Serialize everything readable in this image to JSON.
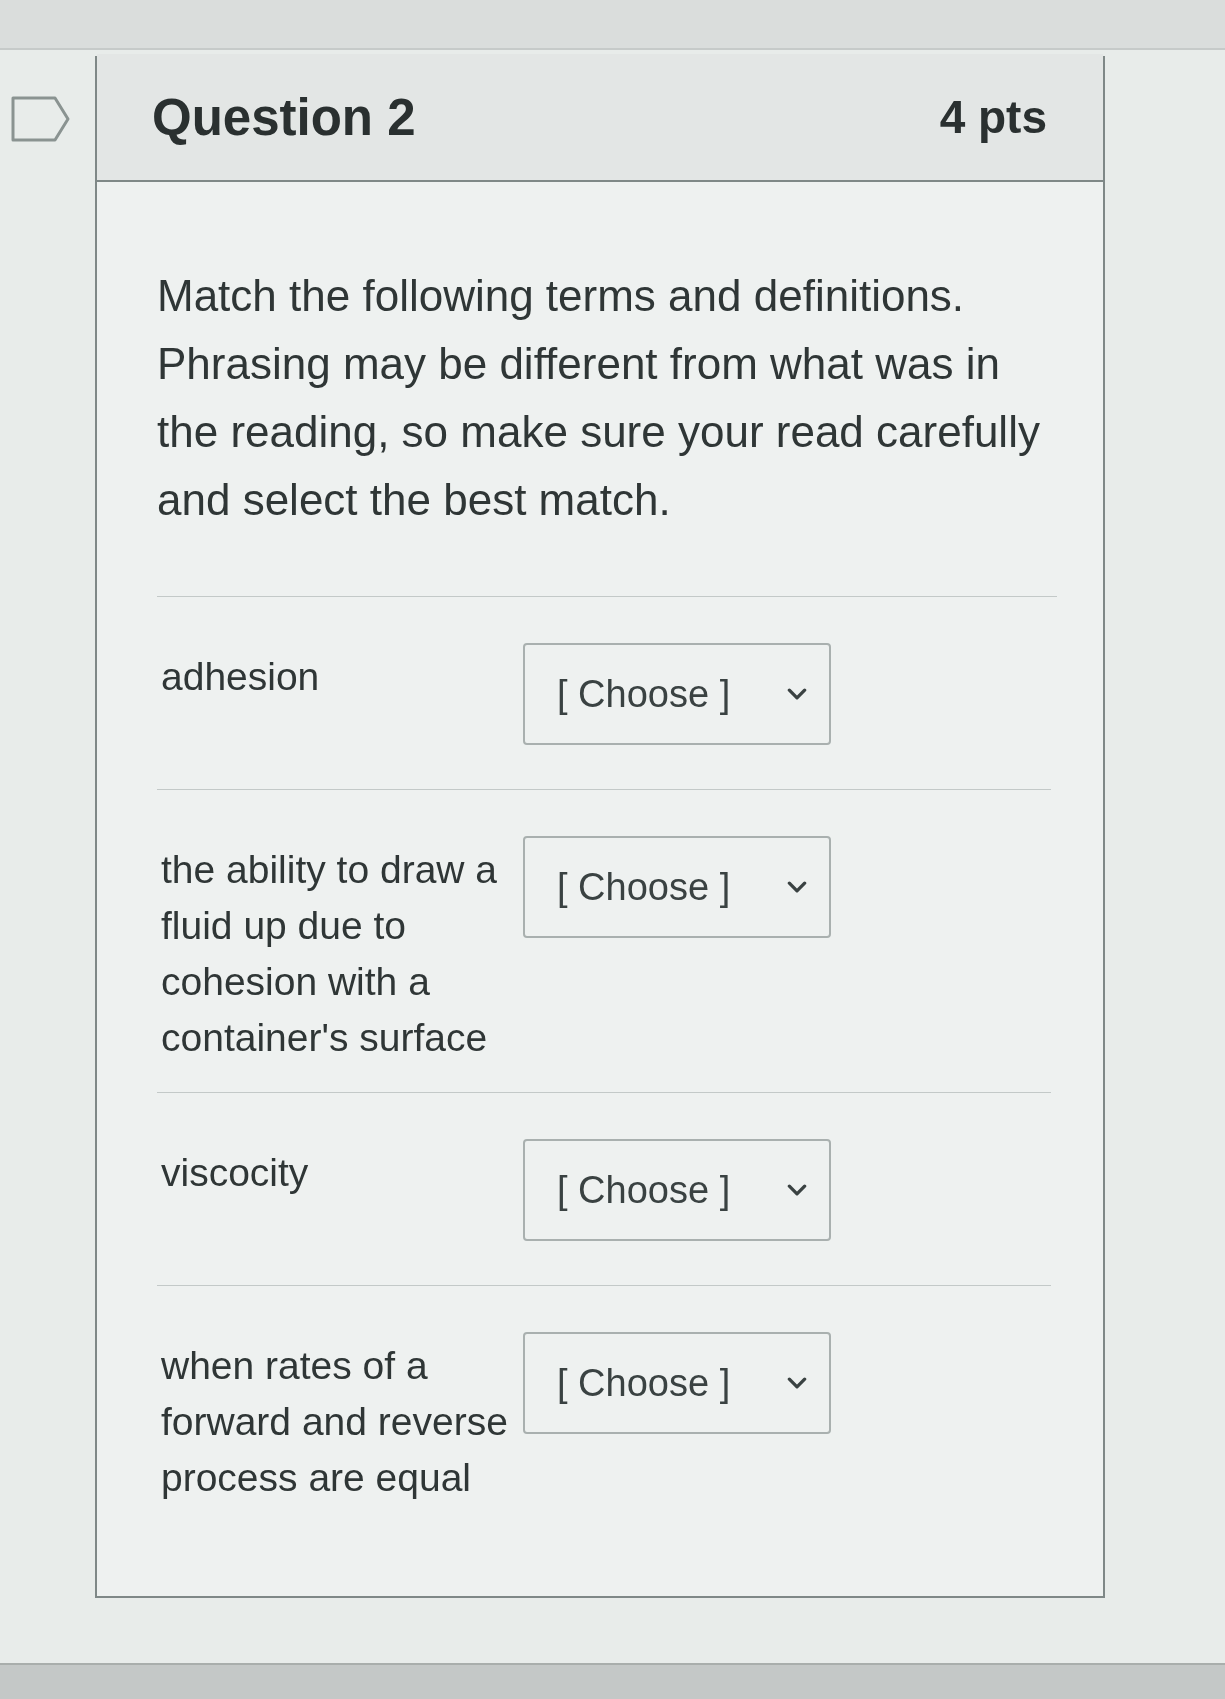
{
  "question": {
    "title": "Question 2",
    "points": "4 pts",
    "flagged": false
  },
  "prompt": "Match the following terms and definitions. Phrasing may be different from what was in the reading, so make sure your read carefully and select the best match.",
  "matches": [
    {
      "term": "adhesion",
      "value": "[ Choose ]"
    },
    {
      "term": "the ability to draw a fluid up due to cohesion with a container's surface",
      "value": "[ Choose ]"
    },
    {
      "term": "viscocity",
      "value": "[ Choose ]"
    },
    {
      "term": "when rates of a forward and reverse process are equal",
      "value": "[ Choose ]"
    }
  ]
}
